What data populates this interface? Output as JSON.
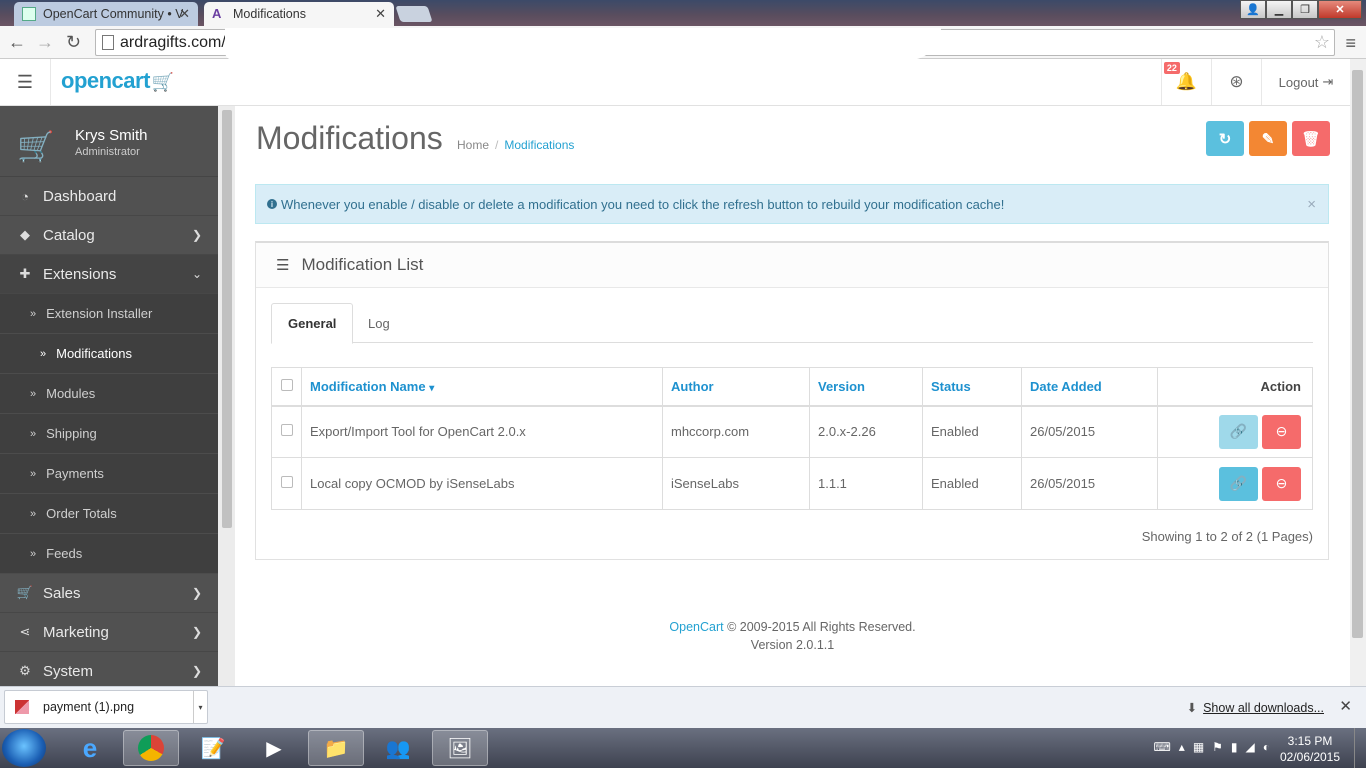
{
  "browser": {
    "tabs": [
      {
        "title": "OpenCart Community • Vi"
      },
      {
        "title": "Modifications"
      }
    ],
    "url": "ardragifts.com/"
  },
  "header": {
    "logo": "opencart",
    "notification_count": "22",
    "logout_label": "Logout"
  },
  "user": {
    "name": "Krys Smith",
    "role": "Administrator"
  },
  "sidebar": {
    "items": [
      {
        "label": "Dashboard",
        "icon": "dashboard-icon"
      },
      {
        "label": "Catalog",
        "icon": "tags-icon"
      },
      {
        "label": "Extensions",
        "icon": "puzzle-icon"
      },
      {
        "label": "Sales",
        "icon": "cart-icon"
      },
      {
        "label": "Marketing",
        "icon": "share-icon"
      },
      {
        "label": "System",
        "icon": "cog-icon"
      }
    ],
    "sub_items": [
      {
        "label": "Extension Installer"
      },
      {
        "label": "Modifications"
      },
      {
        "label": "Modules"
      },
      {
        "label": "Shipping"
      },
      {
        "label": "Payments"
      },
      {
        "label": "Order Totals"
      },
      {
        "label": "Feeds"
      }
    ]
  },
  "page": {
    "title": "Modifications",
    "breadcrumb": {
      "home": "Home",
      "current": "Modifications"
    },
    "alert": "Whenever you enable / disable or delete a modification you need to click the refresh button to rebuild your modification cache!",
    "panel_title": "Modification List",
    "tabs": {
      "general": "General",
      "log": "Log"
    },
    "table": {
      "headers": {
        "name": "Modification Name",
        "author": "Author",
        "version": "Version",
        "status": "Status",
        "date": "Date Added",
        "action": "Action"
      },
      "rows": [
        {
          "name": "Export/Import Tool for OpenCart 2.0.x",
          "author": "mhccorp.com",
          "version": "2.0.x-2.26",
          "status": "Enabled",
          "date": "26/05/2015"
        },
        {
          "name": "Local copy OCMOD by iSenseLabs",
          "author": "iSenseLabs",
          "version": "1.1.1",
          "status": "Enabled",
          "date": "26/05/2015"
        }
      ]
    },
    "showing": "Showing 1 to 2 of 2 (1 Pages)",
    "footer": {
      "brand": "OpenCart",
      "copyright": "© 2009-2015 All Rights Reserved.",
      "version": "Version 2.0.1.1"
    }
  },
  "downloads": {
    "file": "payment (1).png",
    "show_all": "Show all downloads..."
  },
  "taskbar": {
    "time": "3:15 PM",
    "date": "02/06/2015"
  },
  "colors": {
    "brand": "#23a1d1",
    "refresh": "#5bc0de",
    "clear": "#f38733",
    "delete": "#f56b6b",
    "sidebar": "#515151"
  }
}
